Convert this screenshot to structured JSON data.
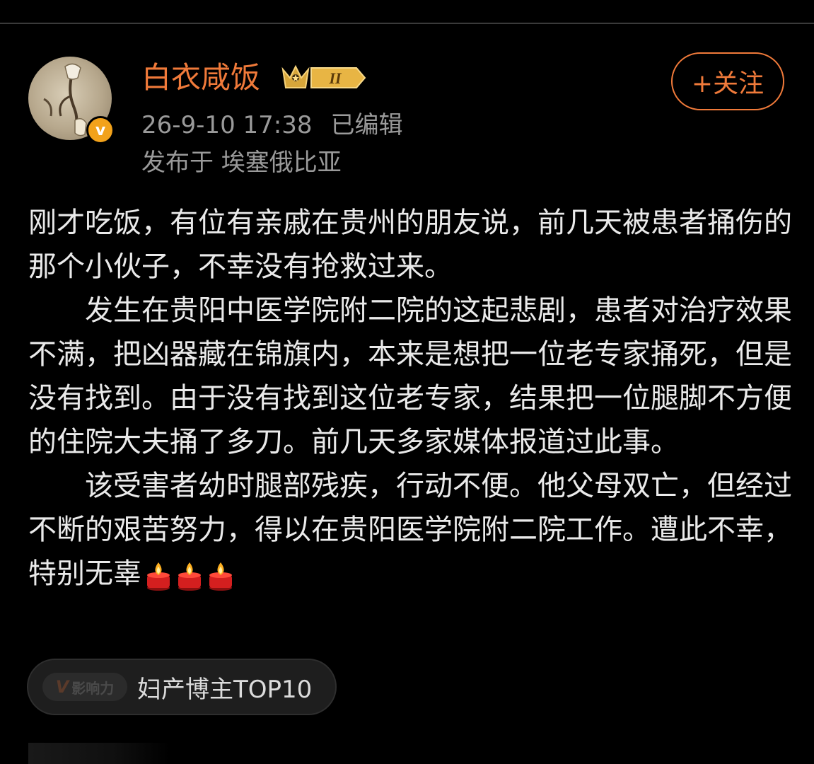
{
  "post": {
    "author": {
      "name": "白衣咸饭",
      "verified_symbol": "v",
      "level_badge": "II"
    },
    "follow_label": "+关注",
    "timestamp": "26-9-10 17:38",
    "edited_label": "已编辑",
    "location": "发布于 埃塞俄比亚",
    "paragraphs": [
      "刚才吃饭，有位有亲戚在贵州的朋友说，前几天被患者捅伤的那个小伙子，不幸没有抢救过来。",
      "　　发生在贵阳中医学院附二院的这起悲剧，患者对治疗效果不满，把凶器藏在锦旗内，本来是想把一位老专家捅死，但是没有找到。由于没有找到这位老专家，结果把一位腿脚不方便的住院大夫捅了多刀。前几天多家媒体报道过此事。",
      "　　该受害者幼时腿部残疾，行动不便。他父母双亡，但经过不断的艰苦努力，得以在贵阳医学院附二院工作。遭此不幸，特别无辜"
    ],
    "trailing_icons": [
      "candle-icon",
      "candle-icon",
      "candle-icon"
    ],
    "influence_tag": {
      "badge_label": "影响力",
      "badge_symbol": "V",
      "text": "妇产博主TOP10"
    }
  },
  "colors": {
    "background": "#000000",
    "accent_orange": "#f07a3a",
    "meta_gray": "#9a9a9a",
    "body_text": "#eaeaea",
    "verified_gold": "#f2a21b"
  }
}
